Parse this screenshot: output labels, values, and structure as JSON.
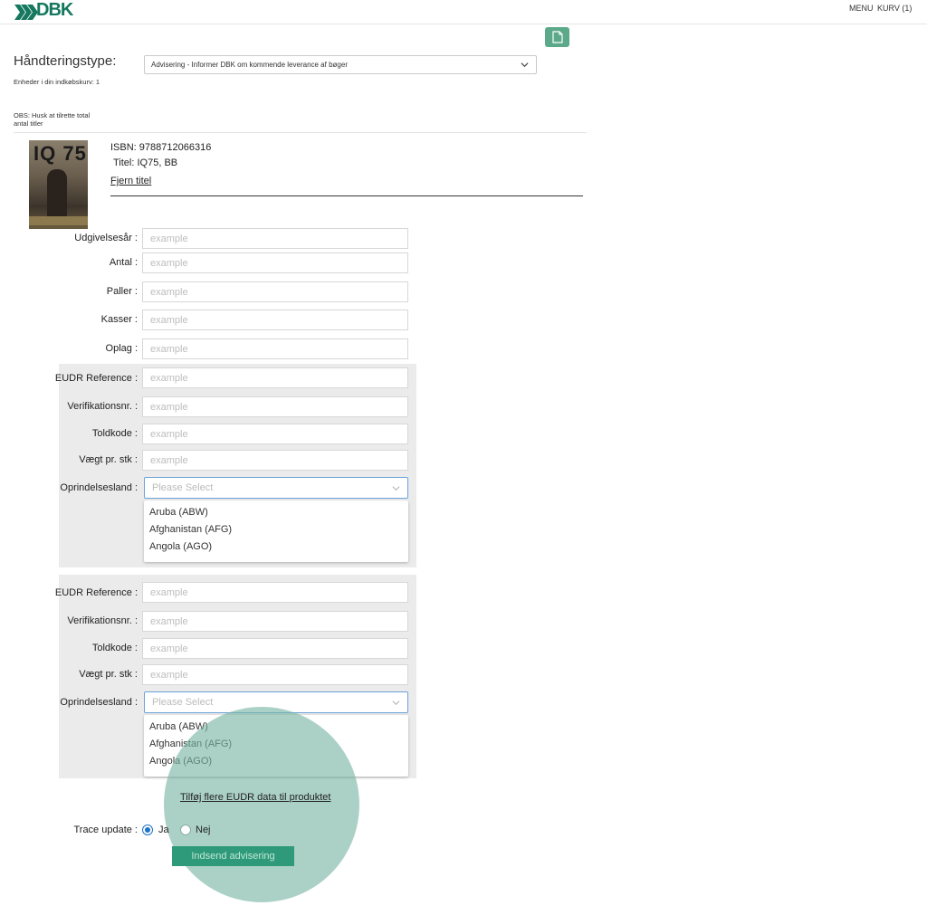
{
  "header": {
    "logo": "DBK",
    "menu": "MENU",
    "cart": "KURV (1)"
  },
  "handling": {
    "label": "Håndteringstype:",
    "selected": "Advisering - Informer DBK om kommende leverance af bøger",
    "units_in_cart": "Enheder i din indkøbskurv: 1",
    "obs": "OBS: Husk at tilrette total antal titler"
  },
  "product": {
    "cover_title": "IQ 75",
    "isbn": "ISBN: 9788712066316",
    "title": "Titel: IQ75, BB",
    "remove": "Fjern titel"
  },
  "fields": [
    {
      "label": "Udgivelsesår :",
      "placeholder": "example"
    },
    {
      "label": "Antal :",
      "placeholder": "example"
    },
    {
      "label": "Paller :",
      "placeholder": "example"
    },
    {
      "label": "Kasser :",
      "placeholder": "example"
    },
    {
      "label": "Oplag :",
      "placeholder": "example"
    }
  ],
  "eudr_blocks": [
    {
      "fields": [
        {
          "label": "EUDR Reference :",
          "placeholder": "example"
        },
        {
          "label": "Verifikationsnr. :",
          "placeholder": "example"
        },
        {
          "label": "Toldkode :",
          "placeholder": "example"
        },
        {
          "label": "Vægt pr. stk :",
          "placeholder": "example"
        }
      ],
      "origin_label": "Oprindelsesland :",
      "origin_placeholder": "Please Select",
      "options": [
        "Aruba (ABW)",
        "Afghanistan (AFG)",
        "Angola (AGO)"
      ]
    },
    {
      "fields": [
        {
          "label": "EUDR Reference :",
          "placeholder": "example"
        },
        {
          "label": "Verifikationsnr. :",
          "placeholder": "example"
        },
        {
          "label": "Toldkode :",
          "placeholder": "example"
        },
        {
          "label": "Vægt pr. stk :",
          "placeholder": "example"
        }
      ],
      "origin_label": "Oprindelsesland :",
      "origin_placeholder": "Please Select",
      "options": [
        "Aruba (ABW)",
        "Afghanistan (AFG)",
        "Angola (AGO)"
      ]
    }
  ],
  "add_more": "Tilføj flere EUDR data til produktet",
  "trace": {
    "label": "Trace update :",
    "yes": "Ja",
    "no": "Nej",
    "selected": "Ja"
  },
  "submit": "Indsend advisering",
  "colors": {
    "brand": "#15785f",
    "button": "#2f9a79",
    "highlight": "#78b4a5"
  }
}
